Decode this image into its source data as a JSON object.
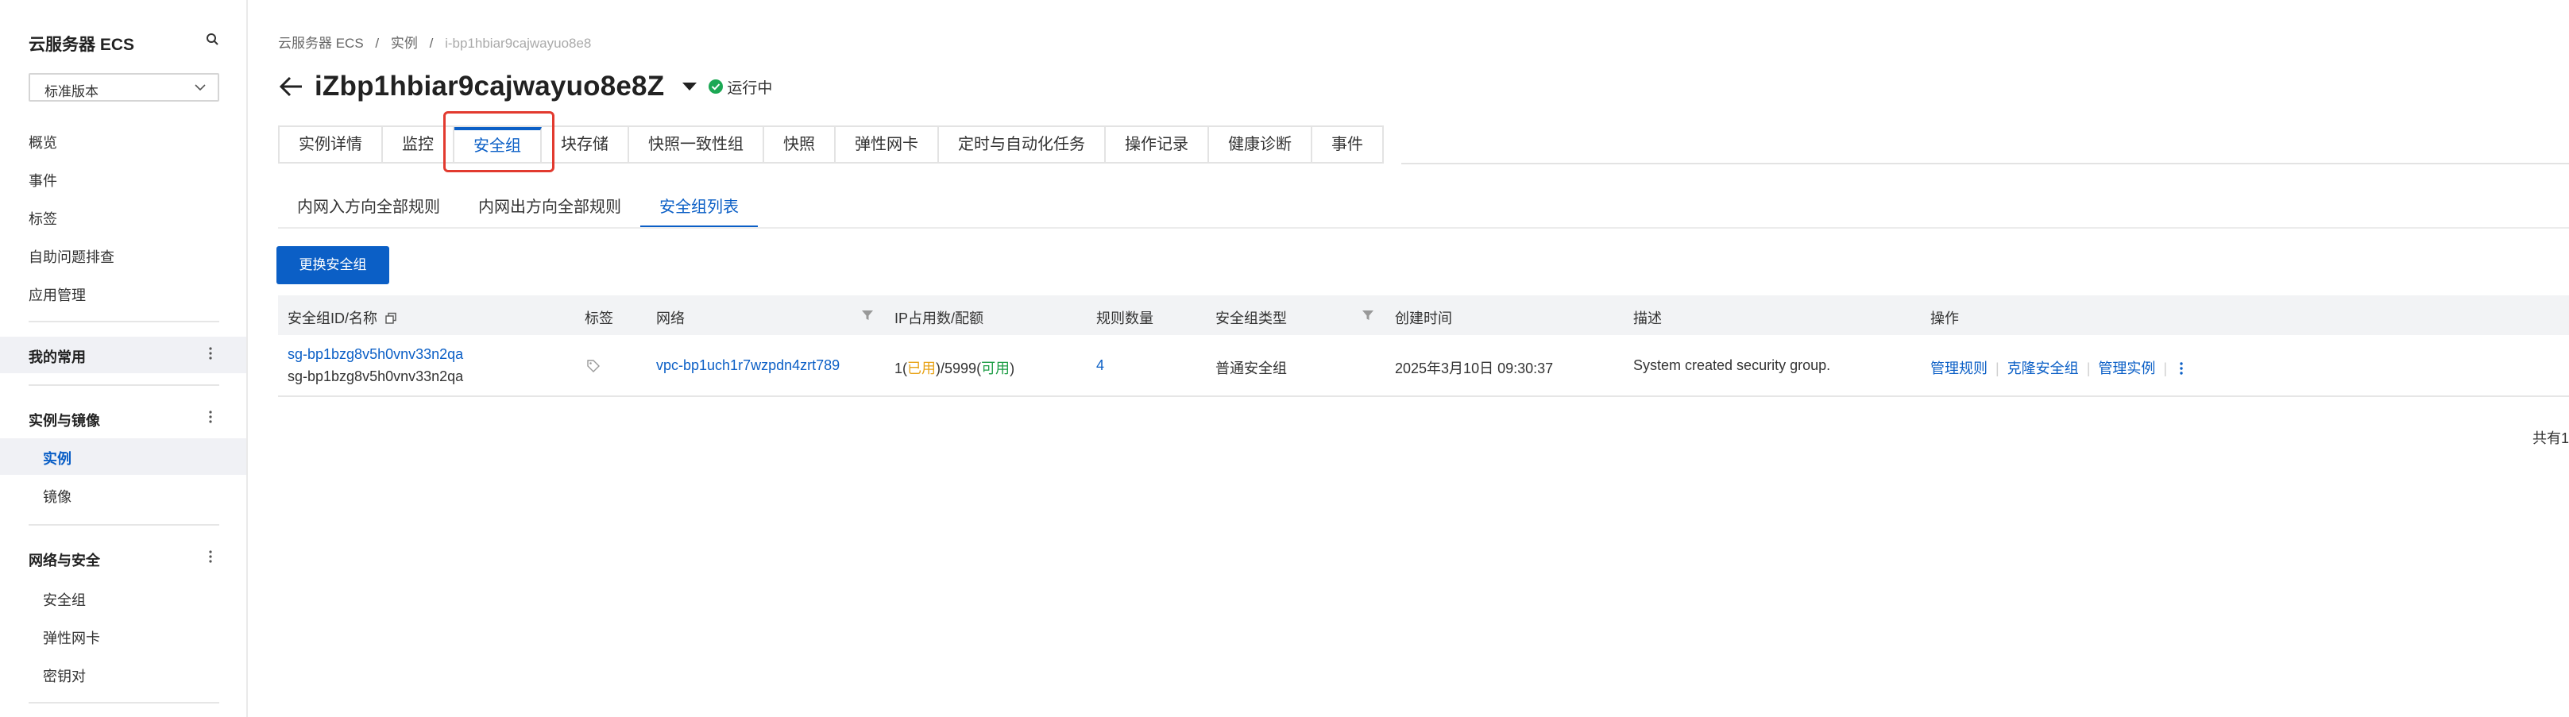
{
  "sidebar": {
    "title": "云服务器 ECS",
    "edition": "标准版本",
    "items": [
      "概览",
      "事件",
      "标签",
      "自助问题排查",
      "应用管理"
    ],
    "groups": [
      {
        "label": "我的常用",
        "items": []
      },
      {
        "label": "实例与镜像",
        "items": [
          "实例",
          "镜像"
        ]
      },
      {
        "label": "网络与安全",
        "items": [
          "安全组",
          "弹性网卡",
          "密钥对"
        ]
      }
    ]
  },
  "breadcrumb": [
    "云服务器 ECS",
    "/",
    "实例",
    "/",
    "i-bp1hbiar9cajwayuo8e8"
  ],
  "header": {
    "title": "iZbp1hbiar9cajwayuo8e8Z",
    "status": "运行中"
  },
  "tabs": [
    "实例详情",
    "监控",
    "安全组",
    "块存储",
    "快照一致性组",
    "快照",
    "弹性网卡",
    "定时与自动化任务",
    "操作记录",
    "健康诊断",
    "事件"
  ],
  "subtabs": [
    "内网入方向全部规则",
    "内网出方向全部规则",
    "安全组列表"
  ],
  "actions": {
    "change_sg": "更换安全组"
  },
  "table": {
    "headers": [
      "安全组ID/名称",
      "标签",
      "网络",
      "IP占用数/配额",
      "规则数量",
      "安全组类型",
      "创建时间",
      "描述",
      "操作"
    ],
    "row": {
      "sg_id": "sg-bp1bzg8v5h0vnv33n2qa",
      "sg_name": "sg-bp1bzg8v5h0vnv33n2qa",
      "vpc": "vpc-bp1uch1r7wzpdn4zrt789",
      "ip_used": "1",
      "ip_used_label": "已用",
      "ip_quota": "5999",
      "ip_avail_label": "可用",
      "rules": "4",
      "type": "普通安全组",
      "created": "2025年3月10日 09:30:37",
      "desc": "System created security group.",
      "ops": [
        "管理规则",
        "克隆安全组",
        "管理实例"
      ]
    }
  },
  "footer": {
    "total": "共有1"
  },
  "colors": {
    "accent": "#0b5fc6",
    "status_green": "#1ca854",
    "highlight": "#e23a2f"
  }
}
